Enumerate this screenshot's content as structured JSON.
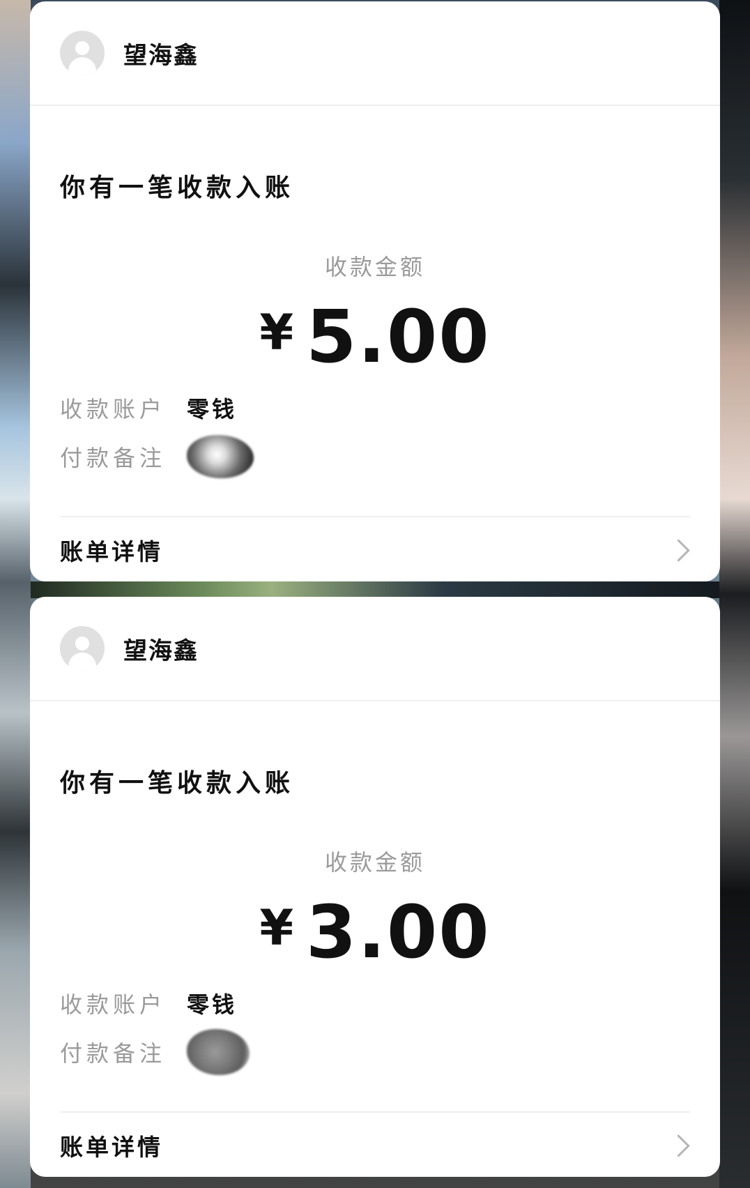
{
  "cards": [
    {
      "sender_name": "望海鑫",
      "title": "你有一笔收款入账",
      "amount_label": "收款金额",
      "currency_symbol": "¥",
      "amount": "5.00",
      "account_label": "收款账户",
      "account_value": "零钱",
      "remark_label": "付款备注",
      "bill_details": "账单详情"
    },
    {
      "sender_name": "望海鑫",
      "title": "你有一笔收款入账",
      "amount_label": "收款金额",
      "currency_symbol": "¥",
      "amount": "3.00",
      "account_label": "收款账户",
      "account_value": "零钱",
      "remark_label": "付款备注",
      "bill_details": "账单详情"
    }
  ],
  "icons": {
    "avatar": "default-user-avatar-icon",
    "chevron": "chevron-right-icon"
  },
  "colors": {
    "card_bg": "#ffffff",
    "primary_text": "#111111",
    "secondary_text": "#9a9a9a",
    "divider": "#efefef"
  }
}
